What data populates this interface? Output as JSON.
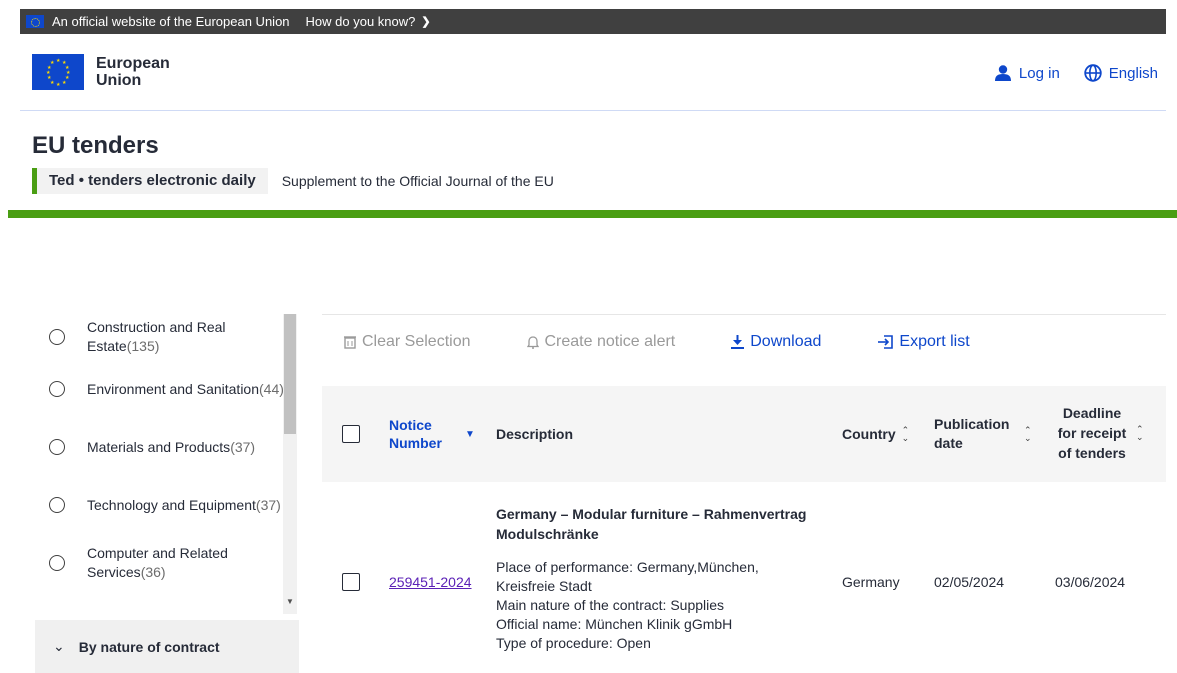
{
  "banner": {
    "official_text": "An official website of the European Union",
    "how_text": "How do you know?"
  },
  "header": {
    "logo_line1": "European",
    "logo_line2": "Union",
    "login_label": "Log in",
    "language_label": "English",
    "accent_color": "#0e47cb"
  },
  "site": {
    "title": "EU tenders",
    "ted_label": "Ted • tenders electronic daily",
    "subtitle": "Supplement to the Official Journal of the EU",
    "brand_green": "#4a9e13"
  },
  "sidebar": {
    "facets": [
      {
        "label": "Construction and Real Estate",
        "count": "(135)"
      },
      {
        "label": "Environment and Sanitation",
        "count": "(44)"
      },
      {
        "label": "Materials and Products",
        "count": "(37)"
      },
      {
        "label": "Technology and Equipment",
        "count": "(37)"
      },
      {
        "label": "Computer and Related Services",
        "count": "(36)"
      }
    ],
    "nature_header": "By nature of contract"
  },
  "toolbar": {
    "clear_selection": "Clear Selection",
    "create_alert": "Create notice alert",
    "download": "Download",
    "export_list": "Export list"
  },
  "table": {
    "headers": {
      "notice_number": "Notice Number",
      "description": "Description",
      "country": "Country",
      "publication_date": "Publication date",
      "deadline": "Deadline for receipt of tenders"
    },
    "rows": [
      {
        "notice_number": "259451-2024",
        "title": "Germany – Modular furniture – Rahmenvertrag Modulschränke",
        "place": "Place of performance: Germany,München, Kreisfreie Stadt",
        "nature": "Main nature of the contract: Supplies",
        "official_name": "Official name: München Klinik gGmbH",
        "procedure": "Type of procedure: Open",
        "country": "Germany",
        "publication_date": "02/05/2024",
        "deadline": "03/06/2024"
      }
    ]
  }
}
